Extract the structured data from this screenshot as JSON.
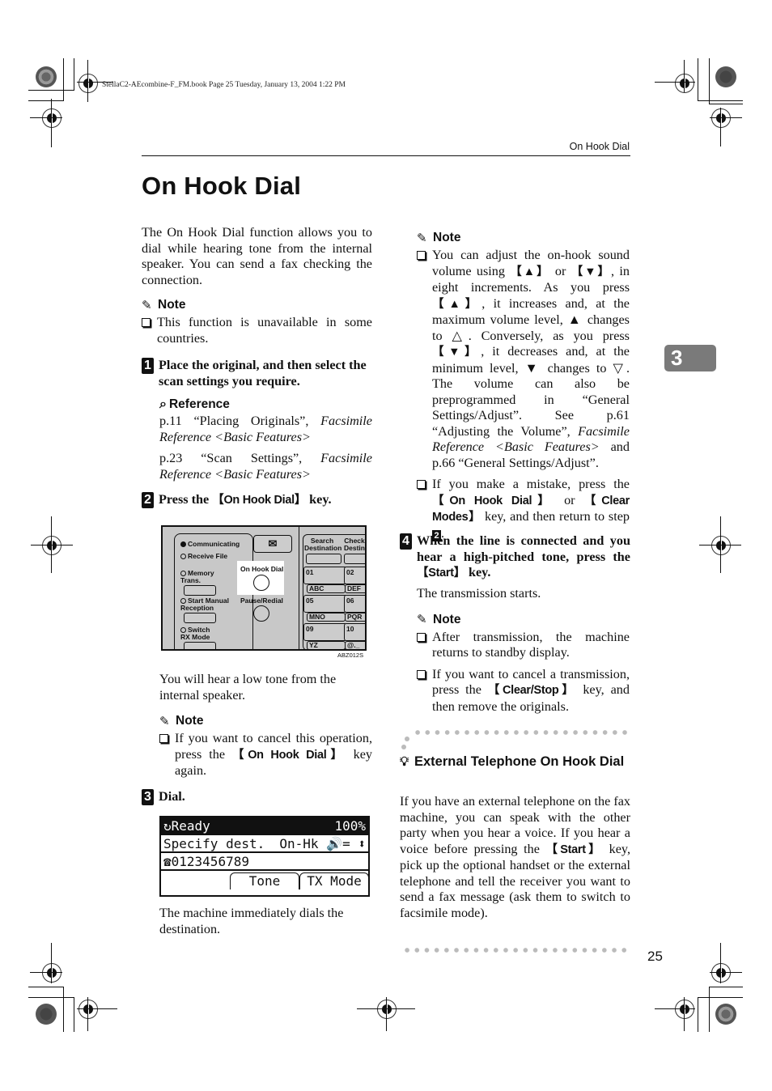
{
  "file_header": "StellaC2-AEcombine-F_FM.book  Page 25  Tuesday, January 13, 2004  1:22 PM",
  "running_head": "On Hook Dial",
  "page_title": "On Hook Dial",
  "chapter_tab": "3",
  "page_number": "25",
  "left": {
    "intro": "The On Hook Dial function allows you to dial while hearing tone from the internal speaker. You can send a fax checking the connection.",
    "note1": {
      "heading": "Note",
      "items": [
        "This function is unavailable in some countries."
      ]
    },
    "step1": {
      "num": "1",
      "text": "Place the original, and then select the scan settings you require."
    },
    "reference": {
      "heading": "Reference",
      "items": [
        {
          "plain": "p.11 “Placing Originals”, ",
          "italic": "Facsimile Reference <Basic Features>"
        },
        {
          "plain": "p.23 “Scan Settings”, ",
          "italic": "Facsimile Reference <Basic Features>"
        }
      ]
    },
    "step2": {
      "num": "2",
      "pre": "Press the ",
      "key": "【On Hook Dial】",
      "post": " key."
    },
    "panel": {
      "leds": [
        "Communicating",
        "Receive File"
      ],
      "memory_trans": "Memory\nTrans.",
      "start_manual": "Start Manual\nReception",
      "switch_rx": "Switch\nRX Mode",
      "on_hook_label": "On Hook Dial",
      "pause_label": "Pause/Redial",
      "search_dest": "Search\nDestination",
      "check_dest": "Check\nDestin",
      "keys": [
        "01",
        "02",
        "ABC",
        "DEF",
        "05",
        "06",
        "MNO",
        "PQR",
        "09",
        "10",
        "YZ",
        "@._"
      ],
      "caption": "ABZ012S"
    },
    "after_step2": "You will hear a low tone from the internal speaker.",
    "note2": {
      "heading": "Note",
      "pre": "If you want to cancel this operation, press the ",
      "key": "【On Hook Dial】",
      "post": " key again."
    },
    "step3": {
      "num": "3",
      "text": "Dial."
    },
    "lcd": {
      "status": "Ready",
      "memory": "100%",
      "line2_left": "Specify dest.",
      "line2_right": "On-Hk",
      "number": "0123456789",
      "soft_keys": [
        "Tone",
        "TX Mode"
      ]
    },
    "after_step3": "The machine immediately dials the destination."
  },
  "right": {
    "note3": {
      "heading": "Note",
      "item1": {
        "t1": "You can adjust the on-hook sound volume using ",
        "k1": "【▲】",
        "t2": " or ",
        "k2": "【▼】",
        "t3": ", in eight increments. As you press ",
        "k3": "【▲】",
        "t4": ", it increases and, at the maximum volume level, ▲ changes to △. Conversely, as you press ",
        "k4": "【▼】",
        "t5": ", it decreases and, at the minimum level, ▼ changes to ▽. The volume can also be preprogrammed in “General Settings/Adjust”. See p.61 “Adjusting the Volume”, ",
        "i1": "Facsimile Reference <Basic Features>",
        "t6": " and p.66 “General Settings/Adjust”."
      },
      "item2": {
        "t1": "If you make a mistake, press the ",
        "k1": "【On Hook Dial】",
        "t2": " or ",
        "k2": "【Clear Modes】",
        "t3": " key, and then return to step ",
        "step": "2",
        "t4": "."
      }
    },
    "step4": {
      "num": "4",
      "pre": "When the line is connected and you hear a high-pitched tone, press the ",
      "key": "【Start】",
      "post": " key."
    },
    "after_step4": "The transmission starts.",
    "note4": {
      "heading": "Note",
      "item1": "After transmission, the machine returns to standby display.",
      "item2_pre": "If you want to cancel a transmission, press the ",
      "item2_key": "【Clear/Stop】",
      "item2_post": " key, and then remove the originals."
    },
    "tip": {
      "heading": "External Telephone On Hook Dial",
      "pre": "If you have an external telephone on the fax machine, you can speak with the other party when you hear a voice. If you hear a voice before pressing the ",
      "key": "【Start】",
      "post": " key, pick up the optional handset or the external telephone and tell the receiver you want to send a fax message (ask them to switch to facsimile mode)."
    }
  }
}
